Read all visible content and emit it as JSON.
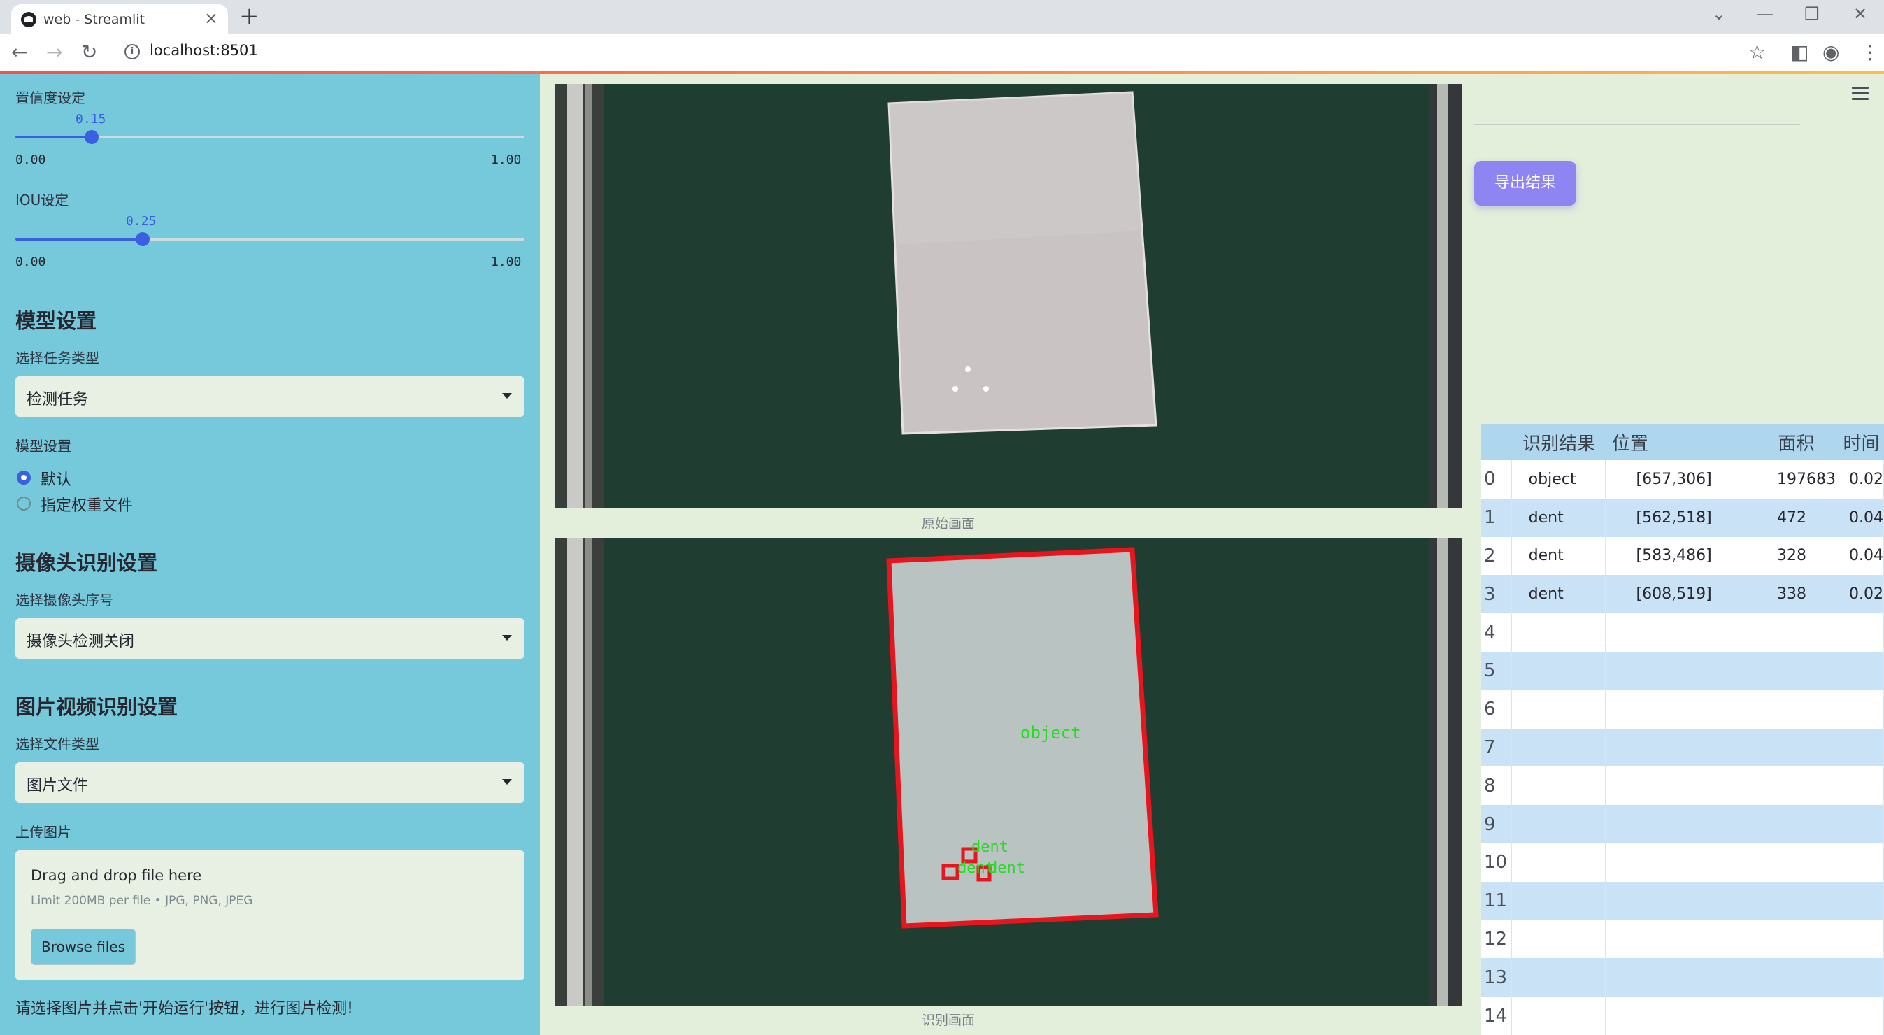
{
  "browser": {
    "tab_title": "web - Streamlit",
    "url": "localhost:8501"
  },
  "sidebar": {
    "confidence": {
      "label": "置信度设定",
      "value": "0.15",
      "min": "0.00",
      "max": "1.00",
      "fraction": 0.15
    },
    "iou": {
      "label": "IOU设定",
      "value": "0.25",
      "min": "0.00",
      "max": "1.00",
      "fraction": 0.25
    },
    "model_section": {
      "heading": "模型设置",
      "task_label": "选择任务类型",
      "task_value": "检测任务",
      "model_label": "模型设置",
      "options": [
        "默认",
        "指定权重文件"
      ],
      "selected": "默认"
    },
    "camera_section": {
      "heading": "摄像头识别设置",
      "camera_label": "选择摄像头序号",
      "camera_value": "摄像头检测关闭"
    },
    "media_section": {
      "heading": "图片视频识别设置",
      "filetype_label": "选择文件类型",
      "filetype_value": "图片文件",
      "upload_label": "上传图片",
      "drop_title": "Drag and drop file here",
      "drop_limit": "Limit 200MB per file • JPG, PNG, JPEG",
      "browse_label": "Browse files"
    },
    "footer_text": "请选择图片并点击'开始运行'按钮，进行图片检测!"
  },
  "main": {
    "original_caption": "原始画面",
    "detected_caption": "识别画面",
    "detection_labels": {
      "object": "object",
      "dent": "dent"
    }
  },
  "right_panel": {
    "export_label": "导出结果",
    "table": {
      "columns": [
        "",
        "识别结果",
        "位置",
        "面积",
        "时间"
      ],
      "rows": [
        {
          "idx": "0",
          "result": "object",
          "position": "[657,306]",
          "area": "197683",
          "time": "0.02"
        },
        {
          "idx": "1",
          "result": "dent",
          "position": "[562,518]",
          "area": "472",
          "time": "0.04"
        },
        {
          "idx": "2",
          "result": "dent",
          "position": "[583,486]",
          "area": "328",
          "time": "0.04"
        },
        {
          "idx": "3",
          "result": "dent",
          "position": "[608,519]",
          "area": "338",
          "time": "0.02"
        },
        {
          "idx": "4",
          "result": "",
          "position": "",
          "area": "",
          "time": ""
        },
        {
          "idx": "5",
          "result": "",
          "position": "",
          "area": "",
          "time": ""
        },
        {
          "idx": "6",
          "result": "",
          "position": "",
          "area": "",
          "time": ""
        },
        {
          "idx": "7",
          "result": "",
          "position": "",
          "area": "",
          "time": ""
        },
        {
          "idx": "8",
          "result": "",
          "position": "",
          "area": "",
          "time": ""
        },
        {
          "idx": "9",
          "result": "",
          "position": "",
          "area": "",
          "time": ""
        },
        {
          "idx": "10",
          "result": "",
          "position": "",
          "area": "",
          "time": ""
        },
        {
          "idx": "11",
          "result": "",
          "position": "",
          "area": "",
          "time": ""
        },
        {
          "idx": "12",
          "result": "",
          "position": "",
          "area": "",
          "time": ""
        },
        {
          "idx": "13",
          "result": "",
          "position": "",
          "area": "",
          "time": ""
        },
        {
          "idx": "14",
          "result": "",
          "position": "",
          "area": "",
          "time": ""
        }
      ]
    }
  },
  "colors": {
    "sidebar_bg": "#76c8db",
    "main_bg": "#e3eedb",
    "accent": "#3a5fe0",
    "export_button": "#8f85f2",
    "box_color": "#e8141e",
    "label_color": "#22dd22"
  }
}
